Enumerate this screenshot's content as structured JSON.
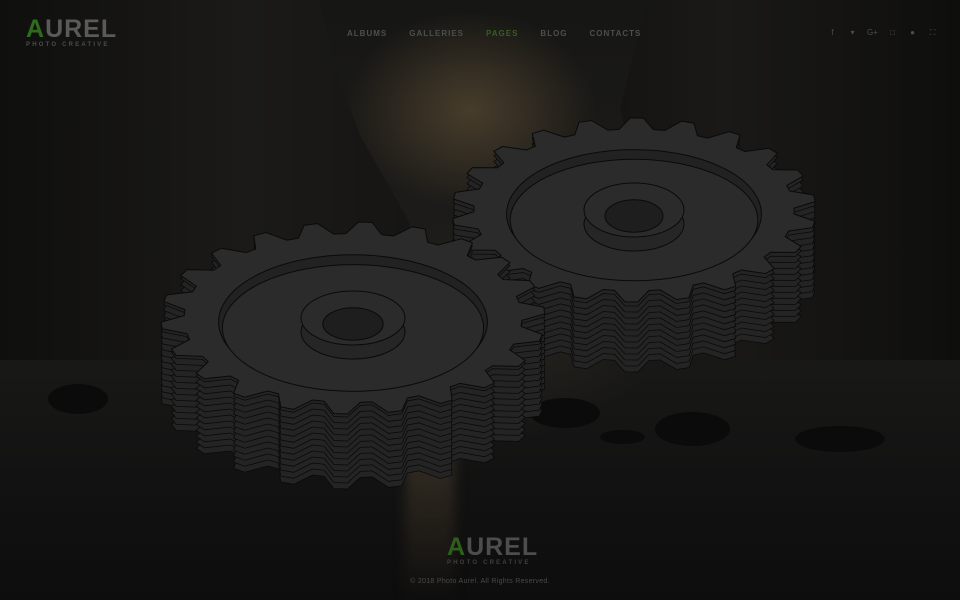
{
  "brand": {
    "logo_accent": "A",
    "logo_rest": "UREL",
    "tagline": "PHOTO CREATIVE"
  },
  "nav": {
    "items": [
      {
        "label": "ALBUMS"
      },
      {
        "label": "GALLERIES"
      },
      {
        "label": "PAGES",
        "active": true
      },
      {
        "label": "BLOG"
      },
      {
        "label": "CONTACTS"
      }
    ]
  },
  "social": {
    "icons": [
      {
        "name": "facebook-icon",
        "glyph": "f"
      },
      {
        "name": "twitter-icon",
        "glyph": "▾"
      },
      {
        "name": "google-plus-icon",
        "glyph": "G+"
      },
      {
        "name": "instagram-icon",
        "glyph": "□"
      },
      {
        "name": "pinterest-icon",
        "glyph": "●"
      },
      {
        "name": "fullscreen-icon",
        "glyph": "⛶"
      }
    ]
  },
  "footer": {
    "logo_accent": "A",
    "logo_rest": "UREL",
    "tagline": "PHOTO CREATIVE",
    "copyright": "© 2018 Photo Aurel. All Rights Reserved."
  },
  "colors": {
    "accent": "#2f6b1e",
    "gear_fill": "#2b2b2b",
    "gear_side": "#242424",
    "gear_stroke": "#0a0a0a"
  }
}
